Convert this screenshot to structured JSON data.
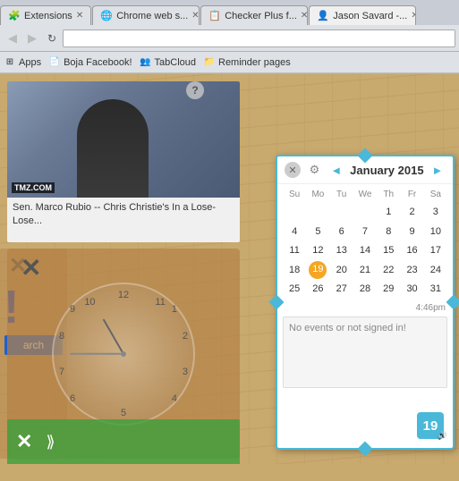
{
  "browser": {
    "tabs": [
      {
        "id": "tab-extensions",
        "label": "Extensions",
        "active": false,
        "icon": "🧩"
      },
      {
        "id": "tab-chrome-web",
        "label": "Chrome web s...",
        "active": false,
        "icon": "●"
      },
      {
        "id": "tab-checker-plus",
        "label": "Checker Plus f...",
        "active": false,
        "icon": "📋"
      },
      {
        "id": "tab-jason",
        "label": "Jason Savard -...",
        "active": true,
        "icon": "👤"
      }
    ],
    "nav": {
      "back_disabled": true,
      "forward_disabled": true,
      "address": ""
    },
    "bookmarks": [
      {
        "label": "Apps",
        "icon": "grid"
      },
      {
        "label": "Boja Facebook!",
        "icon": "page"
      },
      {
        "label": "TabCloud",
        "icon": "people"
      },
      {
        "label": "Reminder pages",
        "icon": "folder"
      }
    ]
  },
  "news": {
    "source": "TMZ.COM",
    "caption": "Sen. Marco Rubio -- Chris Christie's In a Lose-Lose..."
  },
  "help_label": "?",
  "calendar": {
    "title": "January 2015",
    "prev_label": "◄",
    "next_label": "►",
    "close_label": "✕",
    "settings_label": "⚙",
    "day_headers": [
      "Su",
      "Mo",
      "Tu",
      "We",
      "Th",
      "Fr",
      "Sa"
    ],
    "weeks": [
      [
        "",
        "",
        "",
        "",
        "1",
        "2",
        "3"
      ],
      [
        "4",
        "5",
        "6",
        "7",
        "8",
        "9",
        "10"
      ],
      [
        "11",
        "12",
        "13",
        "14",
        "15",
        "16",
        "17"
      ],
      [
        "18",
        "19",
        "20",
        "21",
        "22",
        "23",
        "24"
      ],
      [
        "25",
        "26",
        "27",
        "28",
        "29",
        "30",
        "31"
      ]
    ],
    "today": "19",
    "time": "4:46pm",
    "events_text": "No events or not signed in!",
    "badge_number": "19"
  },
  "clock": {
    "close_label": "✕"
  },
  "bottom_bar": {
    "close_label": "✕"
  }
}
